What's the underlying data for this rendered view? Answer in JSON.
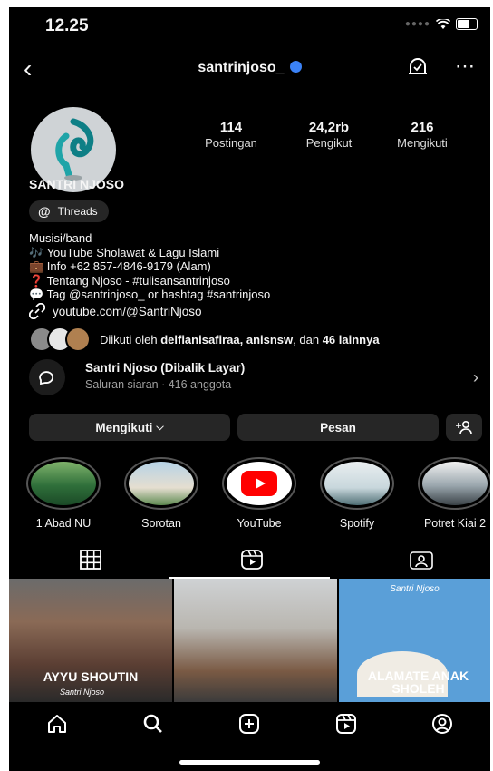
{
  "status": {
    "time": "12.25"
  },
  "header": {
    "username": "santrinjoso_"
  },
  "stats": [
    {
      "value": "114",
      "label": "Postingan"
    },
    {
      "value": "24,2rb",
      "label": "Pengikut"
    },
    {
      "value": "216",
      "label": "Mengikuti"
    }
  ],
  "profile": {
    "name": "SANTRI NJOSO",
    "threads_label": "Threads",
    "category": "Musisi/band",
    "bio_lines": [
      "🎶 YouTube Sholawat & Lagu Islami",
      "💼 Info +62 857-4846-9179 (Alam)",
      "❓ Tentang Njoso - #tulisansantrinjoso",
      "💬 Tag @santrinjoso_ or hashtag #santrinjoso"
    ],
    "link": "youtube.com/@SantriNjoso",
    "followed_by_prefix": "Diikuti oleh ",
    "followed_by_names": "delfianisafiraa, anisnsw",
    "followed_by_mid": ", dan ",
    "followed_by_count": "46 lainnya"
  },
  "channel": {
    "title": "Santri Njoso (Dibalik Layar)",
    "subtitle": "Saluran siaran · 416 anggota"
  },
  "actions": {
    "following": "Mengikuti",
    "message": "Pesan"
  },
  "highlights": [
    {
      "label": "1 Abad NU"
    },
    {
      "label": "Sorotan"
    },
    {
      "label": "YouTube"
    },
    {
      "label": "Spotify"
    },
    {
      "label": "Potret Kiai 2"
    }
  ],
  "posts": [
    {
      "title": "AYYU SHOUTIN",
      "caption": "Santri Njoso"
    },
    {
      "title": "",
      "caption": ""
    },
    {
      "title": "ALAMATE ANAK SHOLEH",
      "caption": "Santri Njoso"
    }
  ]
}
